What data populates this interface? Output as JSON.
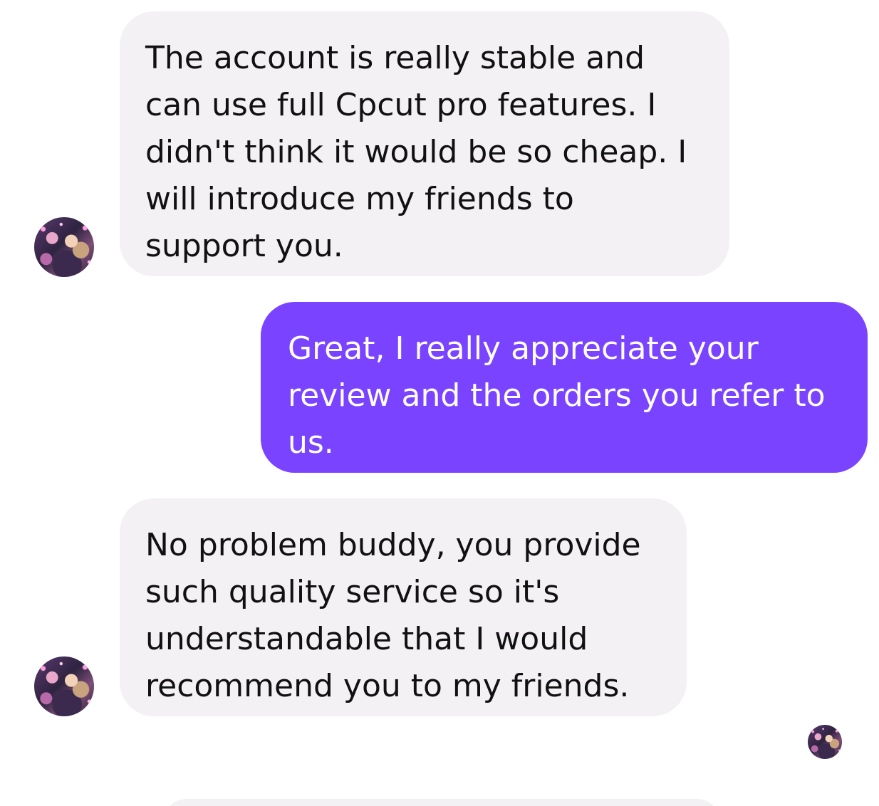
{
  "messages": [
    {
      "direction": "incoming",
      "lines": [
        "The account is really stable and",
        "can use full Cpcut pro features. I",
        "didn't think it would be so cheap. I",
        "will introduce my friends to",
        "support you."
      ]
    },
    {
      "direction": "outgoing",
      "lines": [
        "Great, I really appreciate your",
        "review and the orders you refer to",
        "us."
      ]
    },
    {
      "direction": "incoming",
      "lines": [
        "No problem buddy, you provide",
        "such quality service so it's",
        "understandable that I would",
        "recommend you to my friends."
      ]
    }
  ],
  "colors": {
    "incoming_bubble": "#f4f1f5",
    "outgoing_bubble": "#7a43ff",
    "incoming_text": "#111111",
    "outgoing_text": "#ffffff"
  },
  "icons": {
    "avatar": "contact-photo-avatar",
    "read_receipt": "seen-avatar-icon"
  }
}
